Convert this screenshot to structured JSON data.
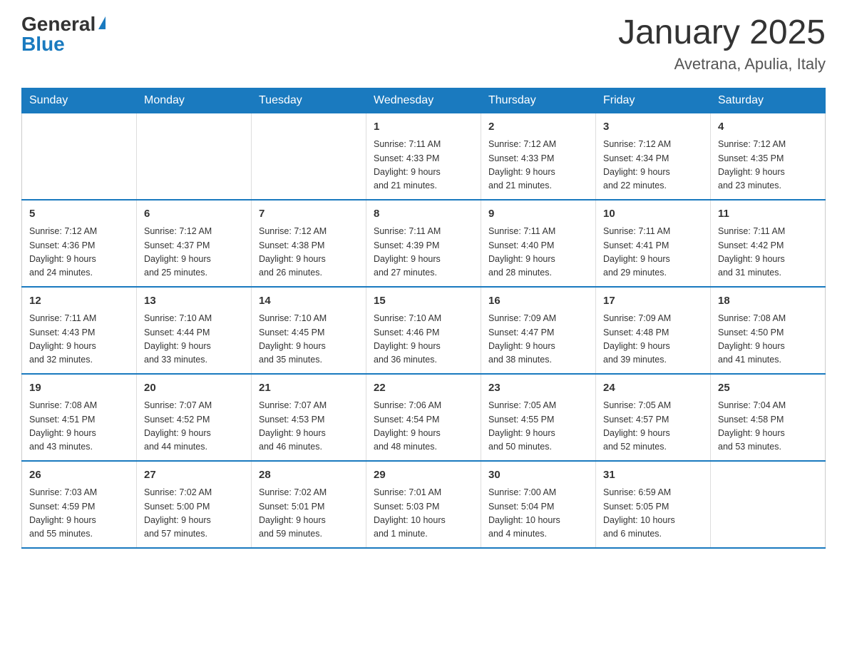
{
  "logo": {
    "general": "General",
    "blue": "Blue"
  },
  "title": "January 2025",
  "location": "Avetrana, Apulia, Italy",
  "days_of_week": [
    "Sunday",
    "Monday",
    "Tuesday",
    "Wednesday",
    "Thursday",
    "Friday",
    "Saturday"
  ],
  "weeks": [
    [
      null,
      null,
      null,
      {
        "day": "1",
        "sunrise": "7:11 AM",
        "sunset": "4:33 PM",
        "daylight": "9 hours and 21 minutes."
      },
      {
        "day": "2",
        "sunrise": "7:12 AM",
        "sunset": "4:33 PM",
        "daylight": "9 hours and 21 minutes."
      },
      {
        "day": "3",
        "sunrise": "7:12 AM",
        "sunset": "4:34 PM",
        "daylight": "9 hours and 22 minutes."
      },
      {
        "day": "4",
        "sunrise": "7:12 AM",
        "sunset": "4:35 PM",
        "daylight": "9 hours and 23 minutes."
      }
    ],
    [
      {
        "day": "5",
        "sunrise": "7:12 AM",
        "sunset": "4:36 PM",
        "daylight": "9 hours and 24 minutes."
      },
      {
        "day": "6",
        "sunrise": "7:12 AM",
        "sunset": "4:37 PM",
        "daylight": "9 hours and 25 minutes."
      },
      {
        "day": "7",
        "sunrise": "7:12 AM",
        "sunset": "4:38 PM",
        "daylight": "9 hours and 26 minutes."
      },
      {
        "day": "8",
        "sunrise": "7:11 AM",
        "sunset": "4:39 PM",
        "daylight": "9 hours and 27 minutes."
      },
      {
        "day": "9",
        "sunrise": "7:11 AM",
        "sunset": "4:40 PM",
        "daylight": "9 hours and 28 minutes."
      },
      {
        "day": "10",
        "sunrise": "7:11 AM",
        "sunset": "4:41 PM",
        "daylight": "9 hours and 29 minutes."
      },
      {
        "day": "11",
        "sunrise": "7:11 AM",
        "sunset": "4:42 PM",
        "daylight": "9 hours and 31 minutes."
      }
    ],
    [
      {
        "day": "12",
        "sunrise": "7:11 AM",
        "sunset": "4:43 PM",
        "daylight": "9 hours and 32 minutes."
      },
      {
        "day": "13",
        "sunrise": "7:10 AM",
        "sunset": "4:44 PM",
        "daylight": "9 hours and 33 minutes."
      },
      {
        "day": "14",
        "sunrise": "7:10 AM",
        "sunset": "4:45 PM",
        "daylight": "9 hours and 35 minutes."
      },
      {
        "day": "15",
        "sunrise": "7:10 AM",
        "sunset": "4:46 PM",
        "daylight": "9 hours and 36 minutes."
      },
      {
        "day": "16",
        "sunrise": "7:09 AM",
        "sunset": "4:47 PM",
        "daylight": "9 hours and 38 minutes."
      },
      {
        "day": "17",
        "sunrise": "7:09 AM",
        "sunset": "4:48 PM",
        "daylight": "9 hours and 39 minutes."
      },
      {
        "day": "18",
        "sunrise": "7:08 AM",
        "sunset": "4:50 PM",
        "daylight": "9 hours and 41 minutes."
      }
    ],
    [
      {
        "day": "19",
        "sunrise": "7:08 AM",
        "sunset": "4:51 PM",
        "daylight": "9 hours and 43 minutes."
      },
      {
        "day": "20",
        "sunrise": "7:07 AM",
        "sunset": "4:52 PM",
        "daylight": "9 hours and 44 minutes."
      },
      {
        "day": "21",
        "sunrise": "7:07 AM",
        "sunset": "4:53 PM",
        "daylight": "9 hours and 46 minutes."
      },
      {
        "day": "22",
        "sunrise": "7:06 AM",
        "sunset": "4:54 PM",
        "daylight": "9 hours and 48 minutes."
      },
      {
        "day": "23",
        "sunrise": "7:05 AM",
        "sunset": "4:55 PM",
        "daylight": "9 hours and 50 minutes."
      },
      {
        "day": "24",
        "sunrise": "7:05 AM",
        "sunset": "4:57 PM",
        "daylight": "9 hours and 52 minutes."
      },
      {
        "day": "25",
        "sunrise": "7:04 AM",
        "sunset": "4:58 PM",
        "daylight": "9 hours and 53 minutes."
      }
    ],
    [
      {
        "day": "26",
        "sunrise": "7:03 AM",
        "sunset": "4:59 PM",
        "daylight": "9 hours and 55 minutes."
      },
      {
        "day": "27",
        "sunrise": "7:02 AM",
        "sunset": "5:00 PM",
        "daylight": "9 hours and 57 minutes."
      },
      {
        "day": "28",
        "sunrise": "7:02 AM",
        "sunset": "5:01 PM",
        "daylight": "9 hours and 59 minutes."
      },
      {
        "day": "29",
        "sunrise": "7:01 AM",
        "sunset": "5:03 PM",
        "daylight": "10 hours and 1 minute."
      },
      {
        "day": "30",
        "sunrise": "7:00 AM",
        "sunset": "5:04 PM",
        "daylight": "10 hours and 4 minutes."
      },
      {
        "day": "31",
        "sunrise": "6:59 AM",
        "sunset": "5:05 PM",
        "daylight": "10 hours and 6 minutes."
      },
      null
    ]
  ]
}
